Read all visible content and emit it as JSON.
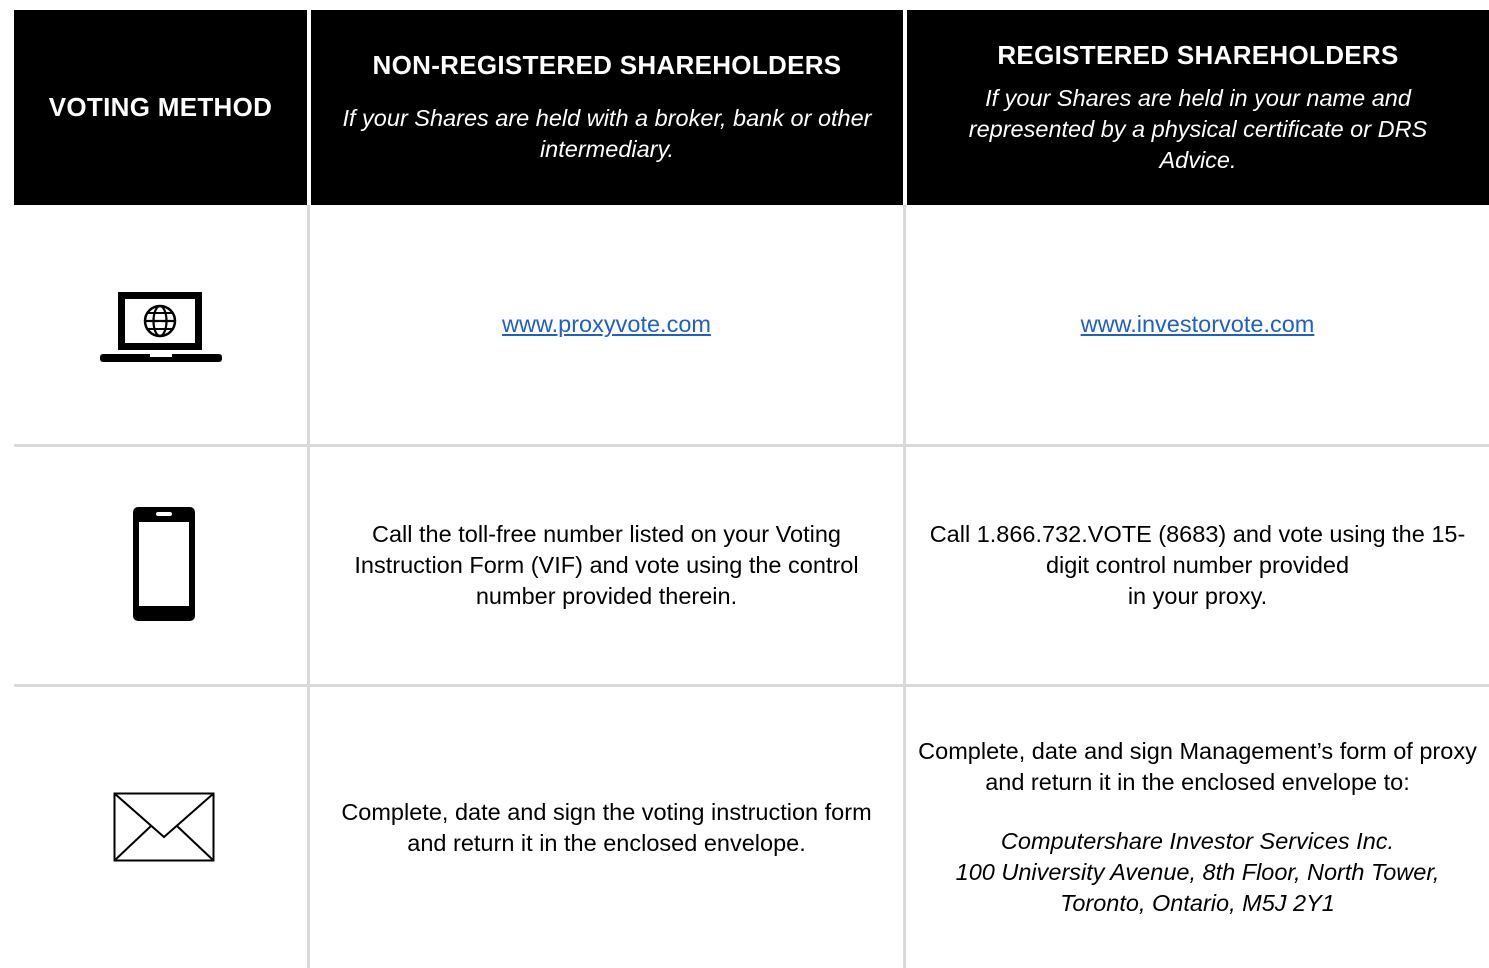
{
  "header": {
    "voting_method": "VOTING METHOD",
    "non_registered": {
      "title": "NON-REGISTERED SHAREHOLDERS",
      "subtitle": "If your Shares are held with a broker, bank or other intermediary."
    },
    "registered": {
      "title": "REGISTERED SHAREHOLDERS",
      "subtitle": "If your Shares are held in your name and represented by a physical certificate or DRS Advice."
    }
  },
  "rows": {
    "internet": {
      "icon": "laptop-globe-icon",
      "non_registered": "www.proxyvote.com",
      "registered": "www.investorvote.com"
    },
    "phone": {
      "icon": "smartphone-icon",
      "non_registered": "Call the toll-free number listed on your Voting Instruction Form (VIF) and vote using the control number provided therein.",
      "registered_line1": "Call 1.866.732.VOTE (8683) and vote using the 15-digit control number provided",
      "registered_line2": "in your proxy."
    },
    "mail": {
      "icon": "envelope-icon",
      "non_registered": "Complete, date and sign the voting instruction form and return it in the enclosed envelope.",
      "registered": "Complete, date and sign Management’s form of proxy and return it in the enclosed envelope to:",
      "address_line1": "Computershare Investor Services Inc.",
      "address_line2": "100 University Avenue, 8th Floor, North Tower,",
      "address_line3": "Toronto, Ontario, M5J 2Y1"
    }
  },
  "colors": {
    "header_bg": "#000000",
    "link": "#1f5fc8",
    "grid": "#d9d9d9"
  }
}
